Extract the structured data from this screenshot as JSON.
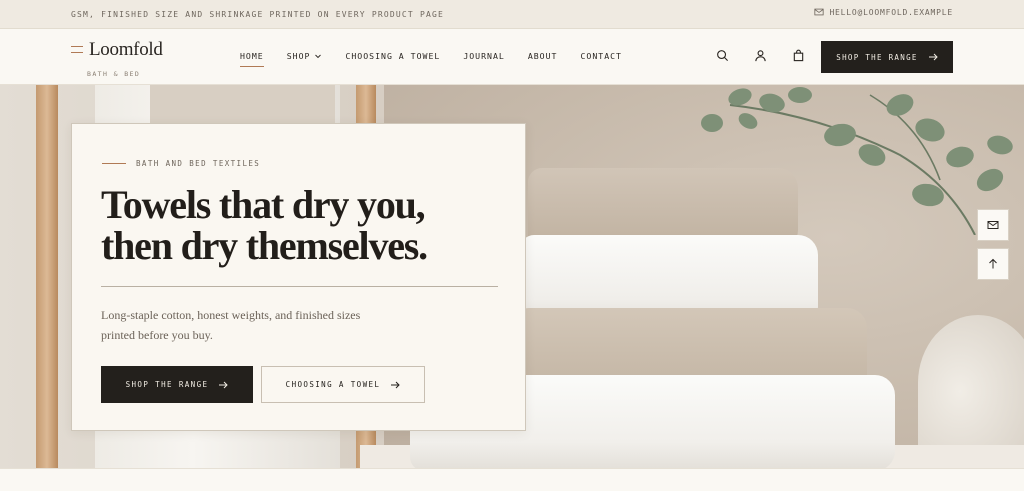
{
  "topbar": {
    "notice": "GSM, FINISHED SIZE AND SHRINKAGE PRINTED ON EVERY PRODUCT PAGE",
    "email": "HELLO@LOOMFOLD.EXAMPLE"
  },
  "brand": {
    "name": "Loomfold",
    "tagline": "BATH & BED",
    "accent_color": "#b07a55"
  },
  "nav": {
    "items": [
      {
        "label": "HOME",
        "active": true
      },
      {
        "label": "SHOP",
        "dropdown": true
      },
      {
        "label": "CHOOSING A TOWEL"
      },
      {
        "label": "JOURNAL"
      },
      {
        "label": "ABOUT"
      },
      {
        "label": "CONTACT"
      }
    ]
  },
  "header_actions": {
    "icons": [
      "search-icon",
      "account-icon",
      "bag-icon"
    ],
    "cta_label": "SHOP THE RANGE",
    "cta_color": "#23201c"
  },
  "hero": {
    "eyebrow": "BATH AND BED TEXTILES",
    "headline_line1": "Towels that dry you,",
    "headline_line2": "then dry themselves.",
    "lede": "Long-staple cotton, honest weights, and finished sizes printed before you buy.",
    "primary_cta": "SHOP THE RANGE",
    "secondary_cta": "CHOOSING A TOWEL"
  },
  "floating": {
    "icons": [
      "mail-icon",
      "arrow-up-icon"
    ]
  }
}
